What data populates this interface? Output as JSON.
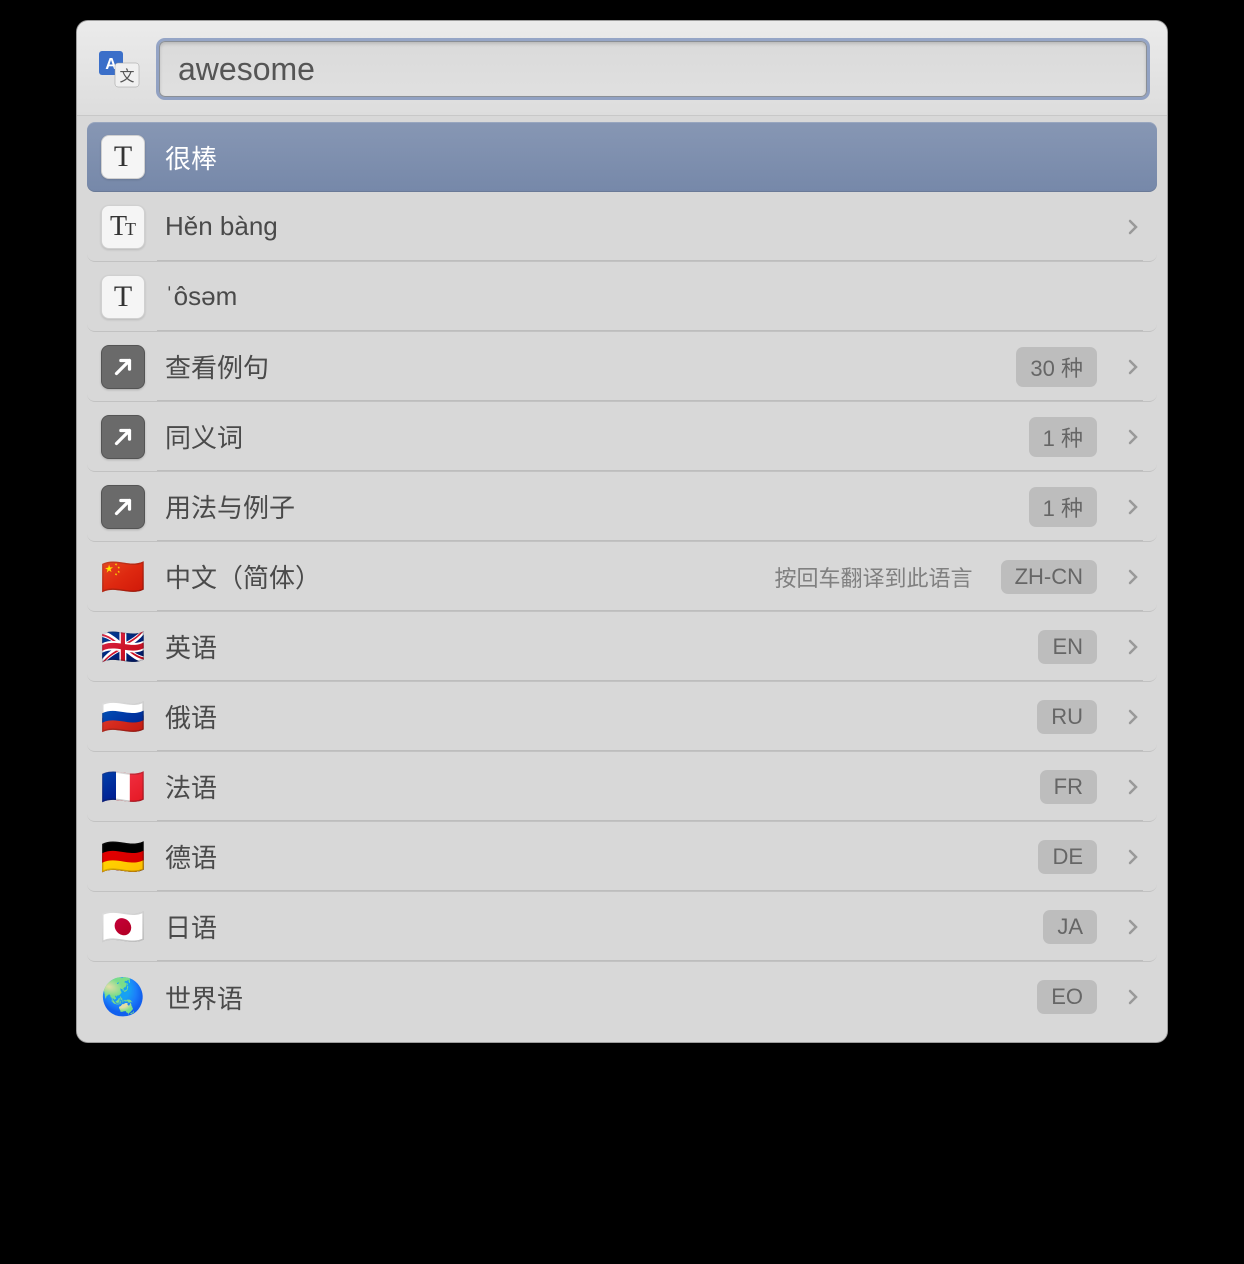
{
  "search": {
    "value": "awesome"
  },
  "results": [
    {
      "id": "translation-primary",
      "iconType": "text-tile",
      "label": "很棒",
      "selected": true,
      "hasChevron": false
    },
    {
      "id": "pinyin",
      "iconType": "tt-tile",
      "label": "Hěn bàng",
      "hasChevron": true
    },
    {
      "id": "phonetic",
      "iconType": "text-tile",
      "label": "ˈôsəm",
      "hasChevron": false
    },
    {
      "id": "examples",
      "iconType": "arrow-tile",
      "label": "查看例句",
      "badge": "30 种",
      "hasChevron": true
    },
    {
      "id": "synonyms",
      "iconType": "arrow-row",
      "label": "同义词",
      "badge": "1 种",
      "hasChevron": true
    },
    {
      "id": "usage",
      "iconType": "arrow-row",
      "label": "用法与例子",
      "badge": "1 种",
      "hasChevron": true
    },
    {
      "id": "lang-zh-cn",
      "iconType": "flag",
      "flag": "🇨🇳",
      "label": "中文（简体）",
      "hint": "按回车翻译到此语言",
      "badge": "ZH-CN",
      "hasChevron": true
    },
    {
      "id": "lang-en",
      "iconType": "flag",
      "flag": "🇬🇧",
      "label": "英语",
      "badge": "EN",
      "hasChevron": true
    },
    {
      "id": "lang-ru",
      "iconType": "flag",
      "flag": "🇷🇺",
      "label": "俄语",
      "badge": "RU",
      "hasChevron": true
    },
    {
      "id": "lang-fr",
      "iconType": "flag",
      "flag": "🇫🇷",
      "label": "法语",
      "badge": "FR",
      "hasChevron": true
    },
    {
      "id": "lang-de",
      "iconType": "flag",
      "flag": "🇩🇪",
      "label": "德语",
      "badge": "DE",
      "hasChevron": true
    },
    {
      "id": "lang-ja",
      "iconType": "flag",
      "flag": "🇯🇵",
      "label": "日语",
      "badge": "JA",
      "hasChevron": true
    },
    {
      "id": "lang-eo",
      "iconType": "globe",
      "flag": "🌏",
      "label": "世界语",
      "badge": "EO",
      "hasChevron": true
    }
  ]
}
